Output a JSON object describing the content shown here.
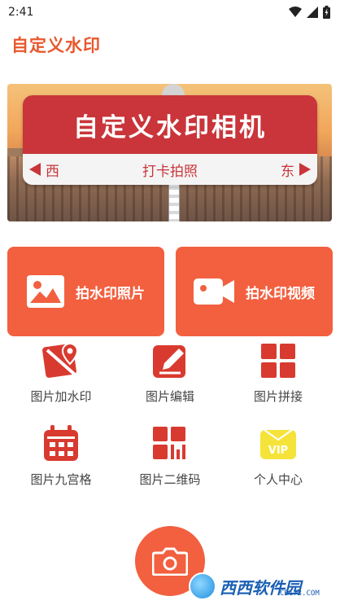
{
  "status_bar": {
    "time": "2:41"
  },
  "app": {
    "title": "自定义水印"
  },
  "banner": {
    "sign_title": "自定义水印相机",
    "left_direction": "西",
    "center_text": "打卡拍照",
    "right_direction": "东"
  },
  "actions": {
    "photo_label": "拍水印照片",
    "video_label": "拍水印视频"
  },
  "grid": {
    "items": [
      {
        "label": "图片加水印",
        "icon": "map-tag-icon"
      },
      {
        "label": "图片编辑",
        "icon": "edit-icon"
      },
      {
        "label": "图片拼接",
        "icon": "grid-icon"
      },
      {
        "label": "图片九宫格",
        "icon": "calendar-grid-icon"
      },
      {
        "label": "图片二维码",
        "icon": "qrcode-icon"
      },
      {
        "label": "个人中心",
        "icon": "vip-icon"
      }
    ]
  },
  "watermark": {
    "brand": "西西软件园",
    "site": "CR173.COM"
  },
  "colors": {
    "accent": "#f2603f",
    "title": "#e8582c",
    "sign_red": "#c9353a"
  }
}
